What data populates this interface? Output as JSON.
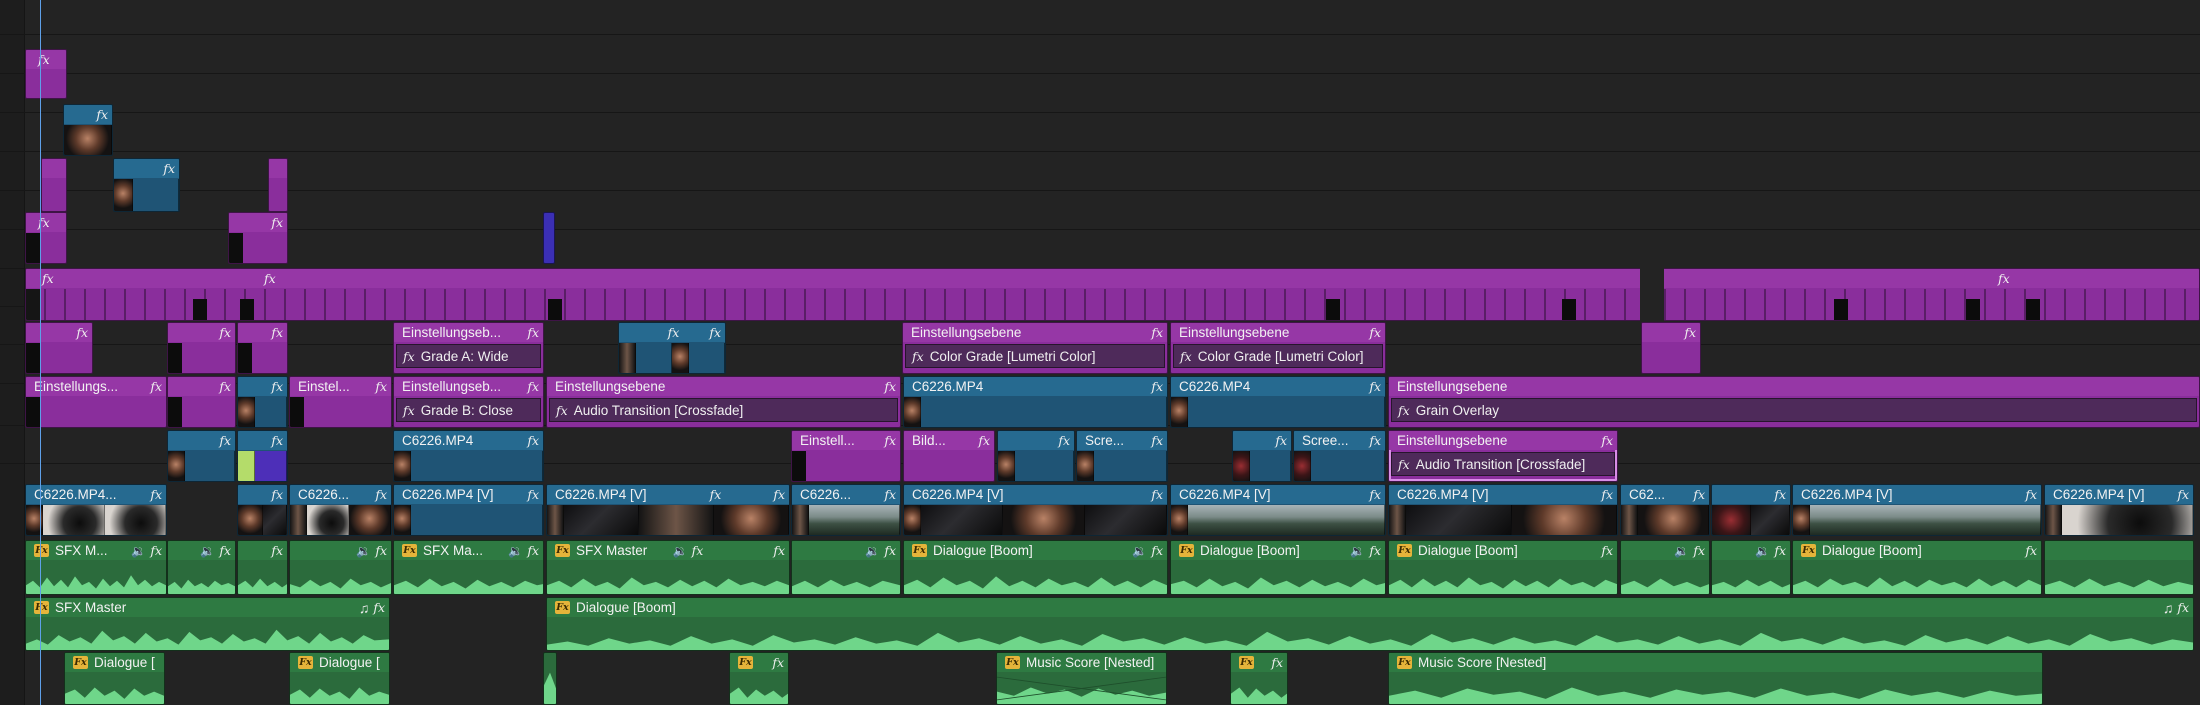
{
  "labels": {
    "einstellungsebene": "Einstellungsebene",
    "einstellungs_dots": "Einstellungs...",
    "einstellungseb_dots": "Einstellungseb...",
    "einstel_dots": "Einstel...",
    "einstell_dots": "Einstell...",
    "bild_dots": "Bild...",
    "scre_dots": "Scre...",
    "scree_dots": "Scree...",
    "c6226_mp4": "C6226.MP4",
    "c6226_mp4_v": "C6226.MP4 [V]",
    "c6226_mp4_dots": "C6226.MP4...",
    "c6226_dots": "C6226...",
    "c62_dots": "C62...",
    "sfx_master": "SFX Master",
    "sfx_m_dots": "SFX M...",
    "sfx_ma_dots": "SFX Ma...",
    "dialogue_boom": "Dialogue [Boom]",
    "dialogue_bracket": "Dialogue [",
    "music_score_nested": "Music Score [Nested]",
    "fx": "fx",
    "fx_badge": "Fx"
  },
  "effects": {
    "grade_a": "Grade A: Wide",
    "grade_b": "Grade B: Close",
    "audio_transition": "Audio Transition [Crossfade]",
    "color_grade": "Color Grade [Lumetri Color]",
    "grain_overlay": "Grain Overlay"
  },
  "icons": {
    "fx": "fx-icon",
    "speaker": "speaker-icon",
    "music_note": "music-note-icon",
    "audio_fx_badge": "audio-fx-badge-icon"
  },
  "colors": {
    "adjustment_layer": "#9637a6",
    "video_clip": "#266a90",
    "audio_clip": "#2e7a42",
    "selected_outline": "#d88ee6",
    "playhead": "#5ea0e8"
  }
}
